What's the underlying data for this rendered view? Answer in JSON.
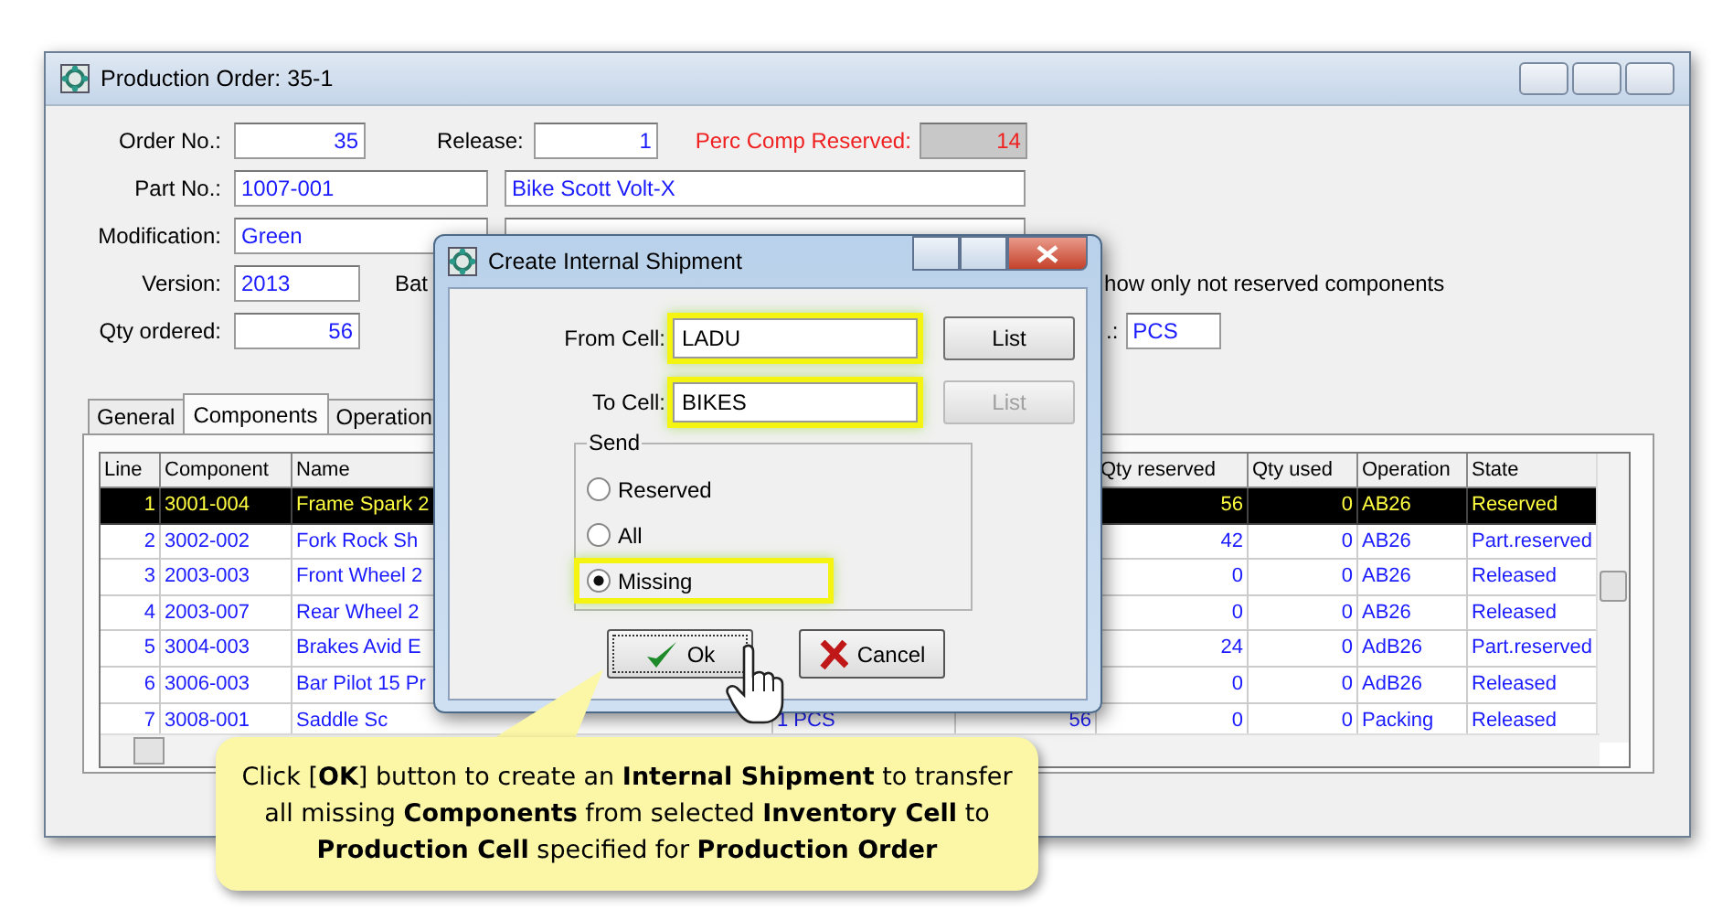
{
  "window": {
    "title": "Production Order: 35-1"
  },
  "form": {
    "order_no": {
      "label": "Order No.:",
      "value": "35"
    },
    "release": {
      "label": "Release:",
      "value": "1"
    },
    "perc_comp_reserved": {
      "label": "Perc Comp Reserved:",
      "value": "14"
    },
    "part_no": {
      "label": "Part No.:",
      "value": "1007-001",
      "description": "Bike Scott Volt-X"
    },
    "modification": {
      "label": "Modification:",
      "value": "Green"
    },
    "version": {
      "label": "Version:",
      "value": "2013"
    },
    "batch_label": "Bat",
    "show_only_label": "how only not reserved components",
    "qty_ordered": {
      "label": "Qty ordered:",
      "value": "56"
    },
    "unit": {
      "label": ".:",
      "value": "PCS"
    }
  },
  "tabs": [
    {
      "label": "General",
      "selected": false
    },
    {
      "label": "Components",
      "selected": true
    },
    {
      "label": "Operation",
      "selected": false
    }
  ],
  "table": {
    "columns": [
      "Line",
      "Component",
      "Name",
      "Qty reserved",
      "Qty used",
      "Operation",
      "State"
    ],
    "rows": [
      {
        "cells": [
          "1",
          "3001-004",
          "Frame Spark 2",
          "56",
          "0",
          "AB26",
          "Reserved"
        ],
        "selected": true
      },
      {
        "cells": [
          "2",
          "3002-002",
          "Fork Rock Sh",
          "42",
          "0",
          "AB26",
          "Part.reserved"
        ],
        "selected": false
      },
      {
        "cells": [
          "3",
          "2003-003",
          "Front Wheel 2",
          "0",
          "0",
          "AB26",
          "Released"
        ],
        "selected": false
      },
      {
        "cells": [
          "4",
          "2003-007",
          "Rear Wheel 2",
          "0",
          "0",
          "AB26",
          "Released"
        ],
        "selected": false
      },
      {
        "cells": [
          "5",
          "3004-003",
          "Brakes Avid E",
          "24",
          "0",
          "AdB26",
          "Part.reserved"
        ],
        "selected": false
      },
      {
        "cells": [
          "6",
          "3006-003",
          "Bar Pilot 15 Pr",
          "0",
          "0",
          "AdB26",
          "Released"
        ],
        "selected": false
      },
      {
        "cells": [
          "7",
          "3008-001",
          "Saddle Sc",
          "0",
          "0",
          "Packing",
          "Released"
        ],
        "selected": false,
        "column_4": "1 PCS",
        "column_5": "56"
      }
    ]
  },
  "dialog": {
    "title": "Create Internal Shipment",
    "from_cell": {
      "label": "From Cell:",
      "value": "LADU",
      "highlighted": true,
      "button": {
        "label": "List",
        "disabled": false
      }
    },
    "to_cell": {
      "label": "To Cell:",
      "value": "BIKES",
      "highlighted": true,
      "button": {
        "label": "List",
        "disabled": true
      }
    },
    "send": {
      "label": "Send",
      "options": [
        {
          "label": "Reserved",
          "selected": false,
          "highlighted": false
        },
        {
          "label": "All",
          "selected": false,
          "highlighted": false
        },
        {
          "label": "Missing",
          "selected": true,
          "highlighted": true
        }
      ]
    },
    "buttons": [
      {
        "label": "Ok",
        "kind": "ok"
      },
      {
        "label": "Cancel",
        "kind": "cancel"
      }
    ]
  },
  "callout": {
    "text": "Click [**OK**] button to create an **Internal Shipment** to transfer all missing **Components** from selected **Inventory Cell** to **Production Cell** specified for **Production Order**"
  }
}
